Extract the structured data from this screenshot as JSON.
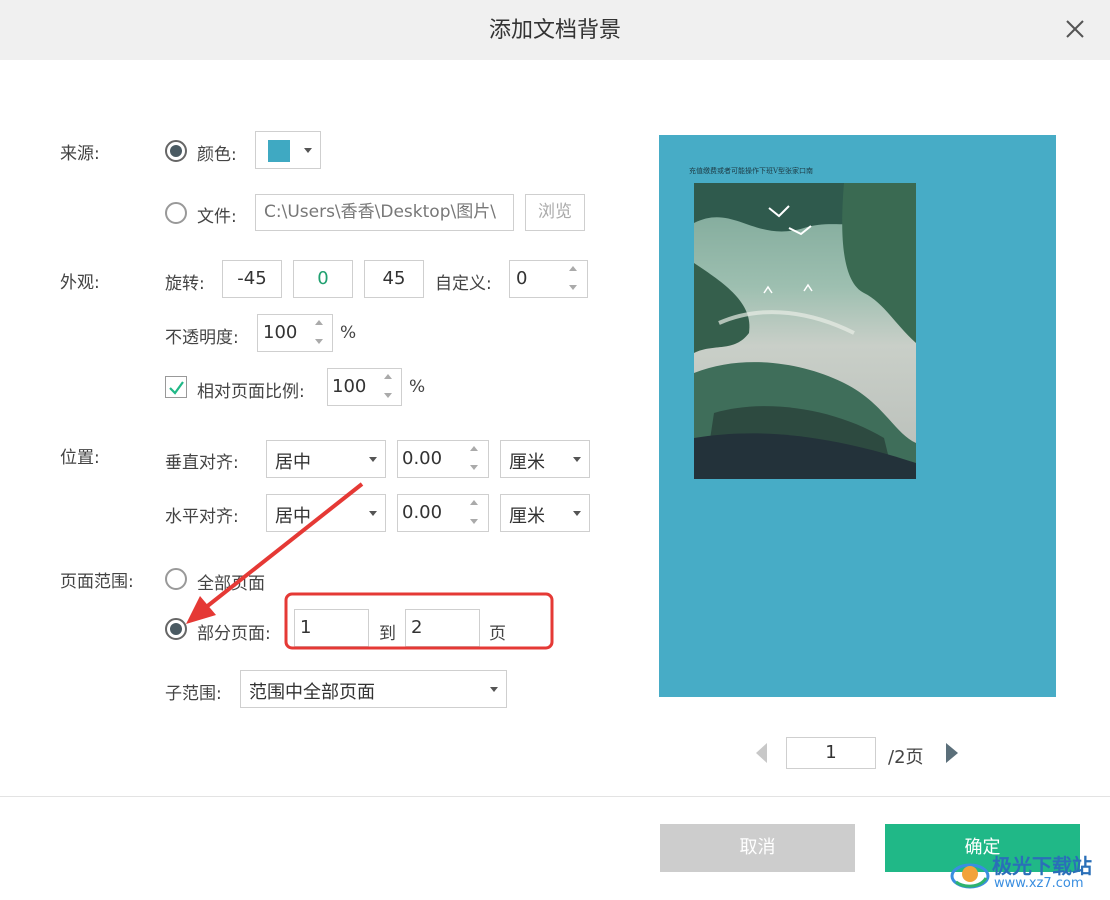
{
  "dialog": {
    "title": "添加文档背景"
  },
  "source": {
    "label": "来源:",
    "color_option": "颜色:",
    "color_value": "#3fa9c2",
    "file_option": "文件:",
    "file_path": "C:\\Users\\香香\\Desktop\\图片\\",
    "browse_button": "浏览"
  },
  "appearance": {
    "label": "外观:",
    "rotation_label": "旋转:",
    "rotation_presets": [
      "-45",
      "0",
      "45"
    ],
    "custom_label": "自定义:",
    "custom_value": "0",
    "opacity_label": "不透明度:",
    "opacity_value": "100",
    "opacity_unit": "%",
    "scale_label": "相对页面比例:",
    "scale_value": "100",
    "scale_unit": "%",
    "scale_checked": true
  },
  "position": {
    "label": "位置:",
    "vertical_label": "垂直对齐:",
    "vertical_align": "居中",
    "vertical_offset": "0.00",
    "vertical_unit": "厘米",
    "horizontal_label": "水平对齐:",
    "horizontal_align": "居中",
    "horizontal_offset": "0.00",
    "horizontal_unit": "厘米"
  },
  "page_range": {
    "label": "页面范围:",
    "all_pages": "全部页面",
    "partial_pages": "部分页面:",
    "from": "1",
    "to_label": "到",
    "to": "2",
    "page_unit": "页",
    "subrange_label": "子范围:",
    "subrange_value": "范围中全部页面",
    "selected": "partial"
  },
  "preview": {
    "doc_header": "充值缴费或者可能操作下班V型张家口南",
    "bg_color": "#47acc6",
    "page_current": "1",
    "page_total": "/2页"
  },
  "footer": {
    "cancel_button": "取消",
    "confirm_button": "确定",
    "confirm_color": "#20b887",
    "cancel_color": "#cdcdcd"
  },
  "watermark": {
    "brand": "极光下载站",
    "url": "www.xz7.com"
  }
}
